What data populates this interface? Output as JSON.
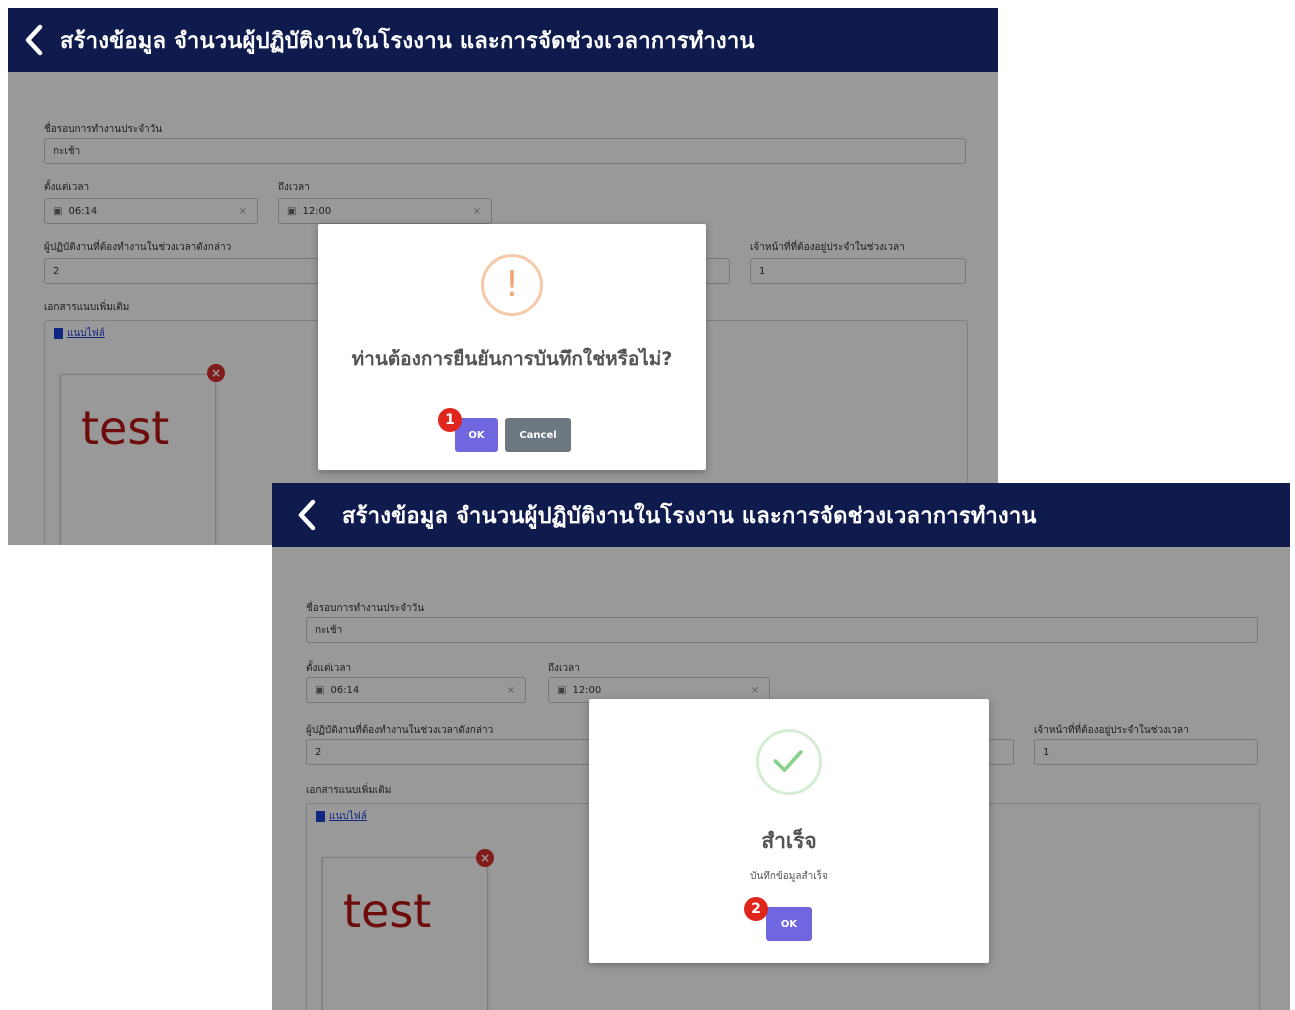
{
  "header": {
    "title": "สร้างข้อมูล จำนวนผู้ปฏิบัติงานในโรงงาน และการจัดช่วงเวลาการทำงาน"
  },
  "form": {
    "shift_label": "ชื่อรอบการทำงานประจำวัน",
    "shift_value": "กะเช้า",
    "start_label": "ตั้งแต่เวลา",
    "start_value": "06:14",
    "end_label": "ถึงเวลา",
    "end_value": "12:00",
    "workers_label": "ผู้ปฏิบัติงานที่ต้องทำงานในช่วงเวลาดังกล่าว",
    "workers_value": "2",
    "officers_label": "เจ้าหน้าที่ที่ต้องอยู่ประจำในช่วงเวลา",
    "officers_value": "1",
    "attach_label": "เอกสารแนบเพิ่มเติม",
    "upload_label": "แนบไฟล์",
    "thumb_text": "test"
  },
  "confirm_dialog": {
    "message": "ท่านต้องการยืนยันการบันทึกใช่หรือไม่?",
    "icon": "!",
    "ok_label": "OK",
    "cancel_label": "Cancel"
  },
  "success_dialog": {
    "title": "สำเร็จ",
    "text": "บันทึกข้อมูลสำเร็จ",
    "ok_label": "OK"
  },
  "markers": {
    "step1": "1",
    "step2": "2"
  },
  "colors": {
    "header": "#0f1b4d",
    "confirm": "#7066e0",
    "cancel": "#6e7881",
    "marker": "#e0251d"
  }
}
